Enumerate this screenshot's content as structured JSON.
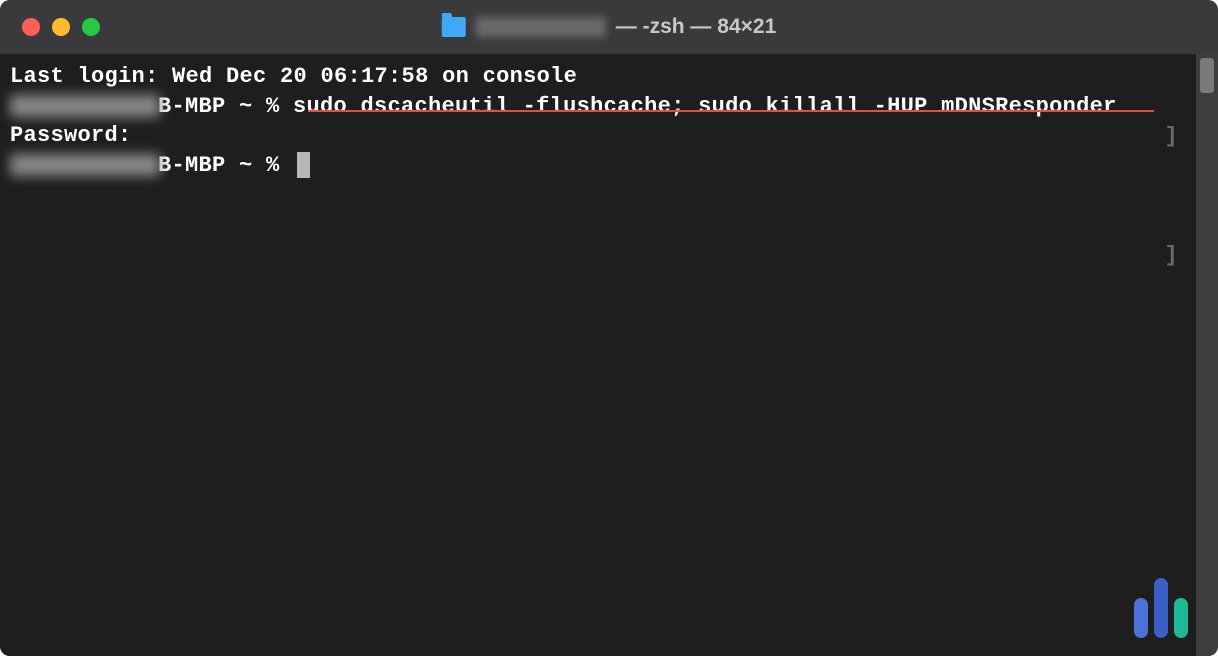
{
  "titlebar": {
    "title_suffix": "— -zsh — 84×21"
  },
  "terminal": {
    "login_line": "Last login: Wed Dec 20 06:17:58 on console",
    "prompt1_suffix": "B-MBP ~ % ",
    "command": "sudo dscacheutil -flushcache; sudo killall -HUP mDNSResponder",
    "password_line": "Password:",
    "prompt2_suffix": "B-MBP ~ % ",
    "bracket_right": "]"
  }
}
